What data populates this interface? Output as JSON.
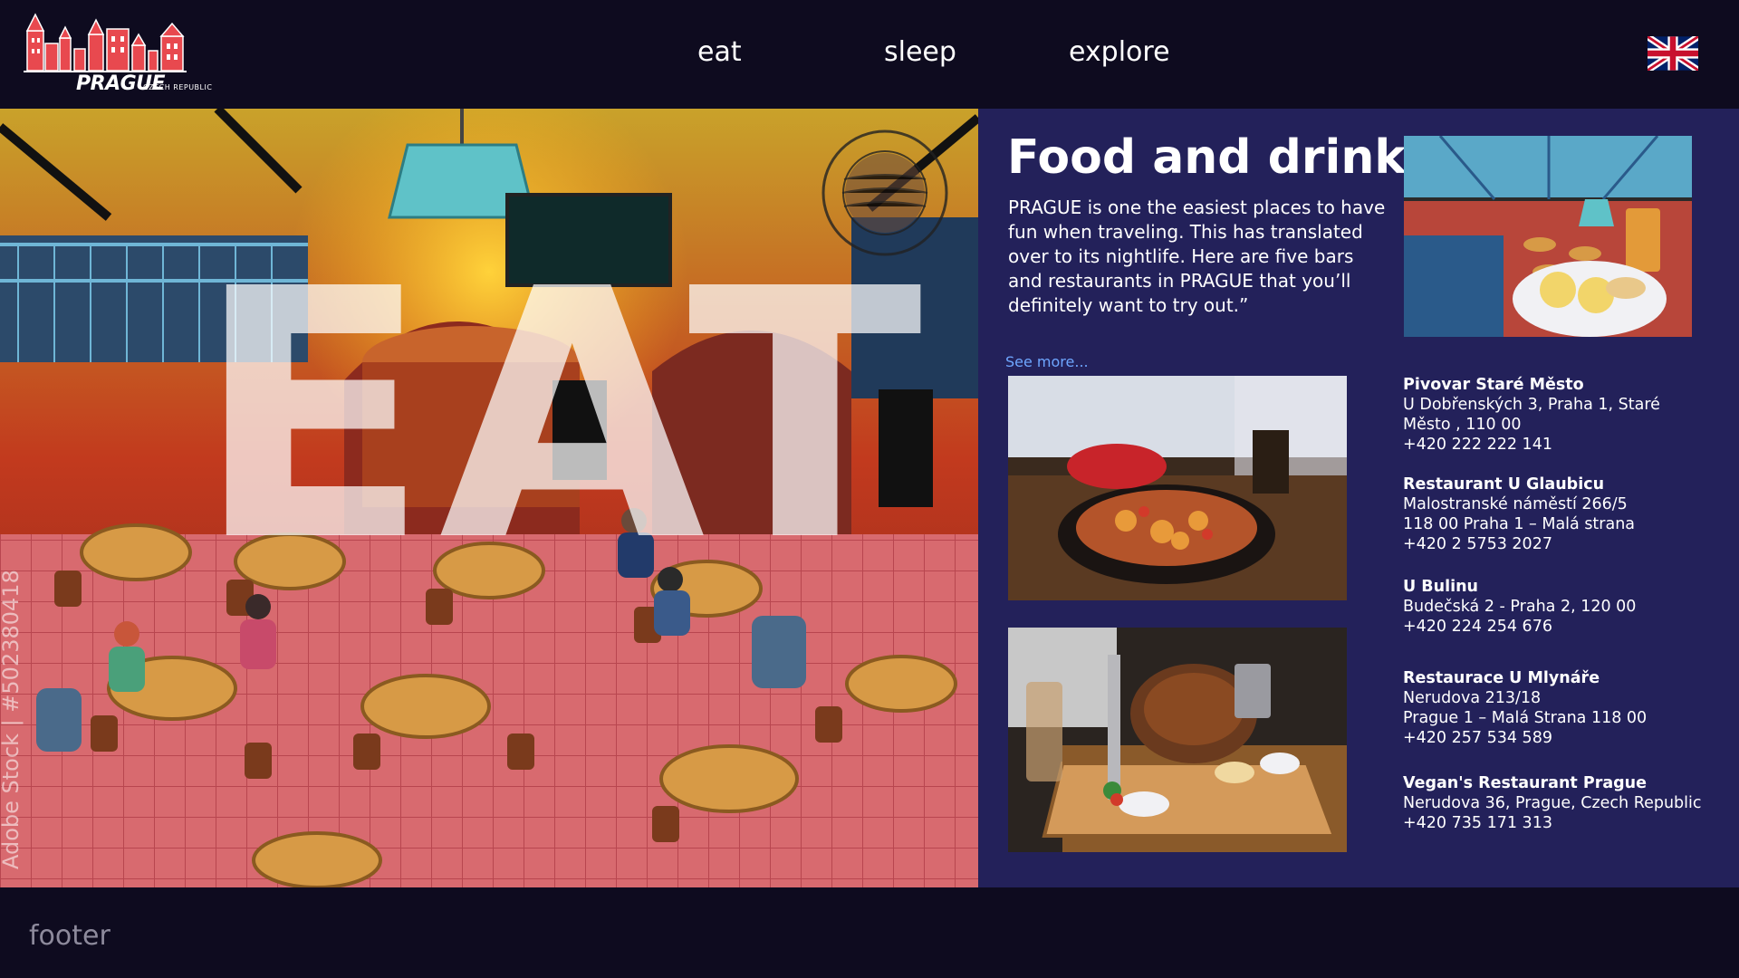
{
  "brand": {
    "logo_text": "PRAGUE",
    "logo_subtext": "CZECH REPUBLIC"
  },
  "nav": {
    "items": [
      {
        "label": "eat"
      },
      {
        "label": "sleep"
      },
      {
        "label": "explore"
      }
    ],
    "language_flag": "uk-flag-icon"
  },
  "hero": {
    "word": "EAT",
    "watermark": "Adobe Stock | #502380418",
    "stamp_text": "PRAGUE"
  },
  "panel": {
    "title": "Food and drink",
    "intro": "PRAGUE is one the easiest places to have fun when traveling. This has translated over to its nightlife. Here are five bars and restaurants in PRAGUE that you’ll definitely want to try out.”",
    "see_more": "See more...",
    "places": [
      {
        "name": "Pivovar Staré Město",
        "lines": [
          "U Dobřenských 3, Praha 1, Staré Město , 110 00",
          "+420 222 222 141"
        ]
      },
      {
        "name": "Restaurant U Glaubicu",
        "lines": [
          "Malostranské náměstí 266/5",
          "118 00 Praha 1 – Malá strana",
          "+420 2 5753 2027"
        ]
      },
      {
        "name": "U Bulinu",
        "lines": [
          "Budečská 2 - Praha 2, 120 00",
          "+420 224 254 676"
        ]
      },
      {
        "name": "Restaurace U Mlynáře",
        "lines": [
          "Nerudova 213/18",
          "Prague 1 – Malá Strana 118 00",
          "+420 257 534 589"
        ]
      },
      {
        "name": "Vegan's Restaurant Prague",
        "lines": [
          "Nerudova 36, Prague, Czech Republic",
          "+420 735 171 313"
        ]
      }
    ]
  },
  "footer": {
    "label": "footer"
  },
  "colors": {
    "header_bg": "#0e0b1f",
    "panel_bg": "#23215a",
    "link": "#6ea6ff",
    "logo_red": "#e8494f"
  }
}
